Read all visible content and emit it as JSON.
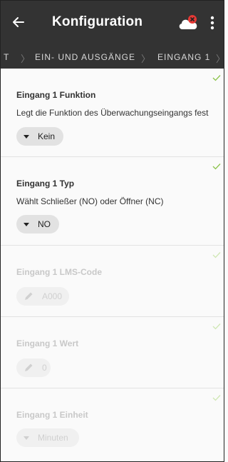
{
  "appbar": {
    "title": "Konfiguration",
    "icons": [
      "back-arrow-icon",
      "cloud-error-icon",
      "more-vert-icon"
    ],
    "accent_error": "#e53935"
  },
  "breadcrumb": {
    "items": [
      "T",
      "EIN- UND AUSGÄNGE",
      "EINGANG 1"
    ]
  },
  "sections": [
    {
      "label": "Eingang 1 Funktion",
      "description": "Legt die Funktion des Überwachungseingangs fest",
      "value": "Kein",
      "control": "dropdown",
      "enabled": true
    },
    {
      "label": "Eingang 1 Typ",
      "description": "Wählt Schließer (NO) oder Öffner (NC)",
      "value": "NO",
      "control": "dropdown",
      "enabled": true
    },
    {
      "label": "Eingang 1 LMS-Code",
      "description": "",
      "value": "A000",
      "control": "edit",
      "enabled": false
    },
    {
      "label": "Eingang 1 Wert",
      "description": "",
      "value": "0",
      "control": "edit",
      "enabled": false
    },
    {
      "label": "Eingang 1 Einheit",
      "description": "",
      "value": "Minuten",
      "control": "dropdown",
      "enabled": false
    }
  ],
  "colors": {
    "header_bg": "#333333",
    "check_green": "#8bc34a"
  }
}
